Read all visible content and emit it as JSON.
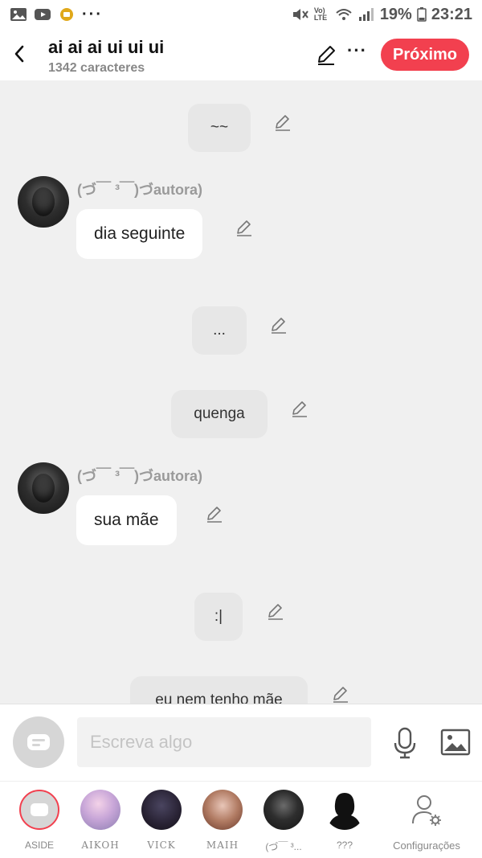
{
  "status_bar": {
    "lte_label": "Vo) LTE",
    "battery": "19%",
    "time": "23:21"
  },
  "header": {
    "title": "ai ai ai ui ui ui",
    "subtitle": "1342 caracteres",
    "next_label": "Próximo"
  },
  "messages": [
    {
      "kind": "narration",
      "text": "~~"
    },
    {
      "kind": "character",
      "sender": "(づ￣ ³￣)づautora)",
      "text": "dia seguinte"
    },
    {
      "kind": "narration",
      "text": "..."
    },
    {
      "kind": "narration",
      "text": "quenga"
    },
    {
      "kind": "character",
      "sender": "(づ￣ ³￣)づautora)",
      "text": "sua mãe"
    },
    {
      "kind": "narration",
      "text": ":|"
    },
    {
      "kind": "narration",
      "text": "eu nem tenho mãe"
    }
  ],
  "composer": {
    "placeholder": "Escreva algo"
  },
  "characters": [
    {
      "label": "ASIDE"
    },
    {
      "label": "AIKOH"
    },
    {
      "label": "VICK"
    },
    {
      "label": "MAIH"
    },
    {
      "label": "(づ￣ ³..."
    },
    {
      "label": "???"
    },
    {
      "label": "Configurações"
    }
  ],
  "colors": {
    "accent": "#f2404f",
    "chat_background": "#f0f0f0",
    "narration_bubble": "#e7e7e7",
    "character_bubble": "#ffffff"
  },
  "icons": {
    "back": "chevron-left-icon",
    "edit": "pencil-icon",
    "more": "more-horizontal-icon",
    "mic": "microphone-icon",
    "image": "image-icon",
    "settings": "user-settings-icon"
  }
}
